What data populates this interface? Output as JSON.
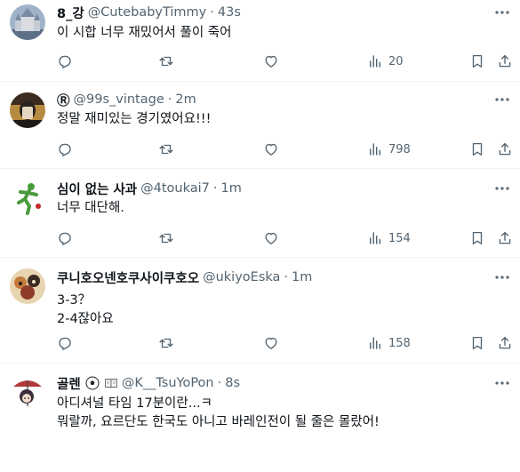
{
  "tweets": [
    {
      "name": "8_강",
      "handle": "@CutebabyTimmy",
      "time": "43s",
      "lines": [
        "이 시합 너무 재밌어서 풀이 죽어"
      ],
      "views": "20",
      "avatar_icon": "castle-avatar"
    },
    {
      "name": "Ⓡ",
      "handle": "@99s_vintage",
      "time": "2m",
      "lines": [
        "정말 재미있는 경기였어요!!!"
      ],
      "views": "798",
      "avatar_icon": "person-photo-avatar"
    },
    {
      "name": "심이 없는 사과",
      "handle": "@4toukai7",
      "time": "1m",
      "lines": [
        "너무 대단해."
      ],
      "views": "154",
      "avatar_icon": "green-runner-avatar"
    },
    {
      "name": "쿠니호오넨호쿠사이쿠호오",
      "handle": "@ukiyoEska",
      "time": "1m",
      "lines": [
        "3-3？",
        "2-4잖아요"
      ],
      "views": "158",
      "avatar_icon": "ukiyoe-avatar"
    },
    {
      "name": "골렌",
      "name_icons": [
        "soccer-ball-icon",
        "book-icon"
      ],
      "handle": "@K__TsuYoPon",
      "time": "8s",
      "lines": [
        "아디셔널 타임 17분이란...ㅋ",
        "뭐랄까, 요르단도 한국도 아니고 바레인전이 될 줄은 몰랐어!"
      ],
      "views": "",
      "avatar_icon": "anime-girl-avatar"
    }
  ],
  "colors": {
    "text": "#0f1419",
    "muted": "#536471",
    "divider": "#eff3f4"
  },
  "icons": [
    "reply-icon",
    "retweet-icon",
    "like-icon",
    "views-icon",
    "bookmark-icon",
    "share-icon",
    "more-icon"
  ]
}
